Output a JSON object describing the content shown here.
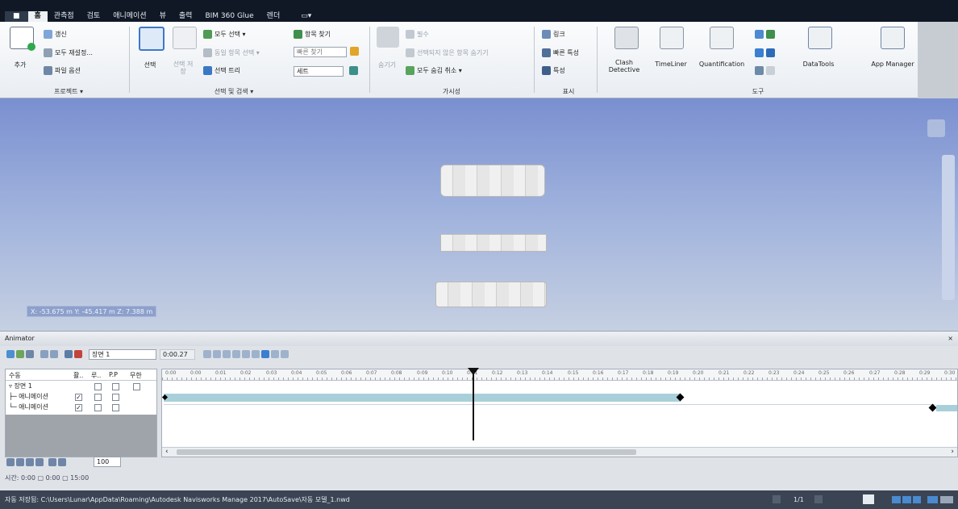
{
  "tabbar": {
    "app_button": "■",
    "tabs": [
      "홈",
      "관측점",
      "검토",
      "애니메이션",
      "뷰",
      "출력",
      "BIM 360 Glue",
      "렌더"
    ],
    "active_tab": "홈",
    "extra": "▭▾"
  },
  "ribbon": {
    "project": {
      "add": "추가",
      "refresh": "갱신",
      "reset_all": "모두 재설정...",
      "file_options": "파일 옵션",
      "group_label": "프로젝트 ▾"
    },
    "select": {
      "select_btn": "선택",
      "save_selection": "선택 저장",
      "select_all": "모두 선택 ▾",
      "select_same": "동일 항목 선택 ▾",
      "selection_tree": "선택 트리",
      "find_items": "항목 찾기",
      "quick_find_placeholder": "빠른 찾기",
      "sets": "세트",
      "group_label": "선택 및 검색 ▾"
    },
    "visibility": {
      "hide": "숨기기",
      "require": "필수",
      "hide_unselected": "선택되지 않은 항목 숨기기",
      "unhide_all": "모두 숨김 취소 ▾",
      "group_label": "가시성"
    },
    "display": {
      "links": "링크",
      "quick_props": "빠른 특성",
      "properties": "특성",
      "group_label": "표시"
    },
    "tools": {
      "clash": "Clash Detective",
      "timeliner": "TimeLiner",
      "quantification": "Quantification",
      "datatools": "DataTools",
      "appmanager": "App Manager",
      "group_label": "도구"
    }
  },
  "viewport": {
    "coords": "X: -53.675 m  Y: -45.417 m  Z: 7.388 m"
  },
  "animator": {
    "title": "Animator",
    "close": "×",
    "scene_select": "장면 1",
    "time_value": "0:00.27",
    "tree_headers": [
      "수동",
      "활..",
      "루..",
      "P.P",
      "무한"
    ],
    "tree_rows": [
      {
        "label": "▿ 장면 1",
        "checked": false
      },
      {
        "label": "├─ 애니메이션",
        "checked": true
      },
      {
        "label": "└─ 애니메이션",
        "checked": true
      }
    ],
    "zoom_label": "100",
    "bottom_fields": "시간:  0:00  ▢ 0:00  ▢ 15:00"
  },
  "timeline": {
    "ticks": [
      "0:00",
      "0:00",
      "0:01",
      "0:02",
      "0:03",
      "0:04",
      "0:05",
      "0:06",
      "0:07",
      "0:08",
      "0:09",
      "0:10",
      "0:11",
      "0:12",
      "0:13",
      "0:14",
      "0:15",
      "0:16",
      "0:17",
      "0:18",
      "0:19",
      "0:20",
      "0:21",
      "0:22",
      "0:23",
      "0:24",
      "0:25",
      "0:26",
      "0:27",
      "0:28",
      "0:29",
      "0:30"
    ],
    "playhead_fraction": 0.39,
    "bar1_end_fraction": 0.65,
    "bar2_end_fraction": 0.97
  },
  "statusbar": {
    "path": "자동 저장됨: C:\\Users\\Lunar\\AppData\\Roaming\\Autodesk Navisworks Manage 2017\\AutoSave\\자동 모델_1.nwd",
    "page": "1/1"
  },
  "colors": {
    "timeline_bar": "#a9d0da",
    "accent": "#2a6fd4"
  }
}
